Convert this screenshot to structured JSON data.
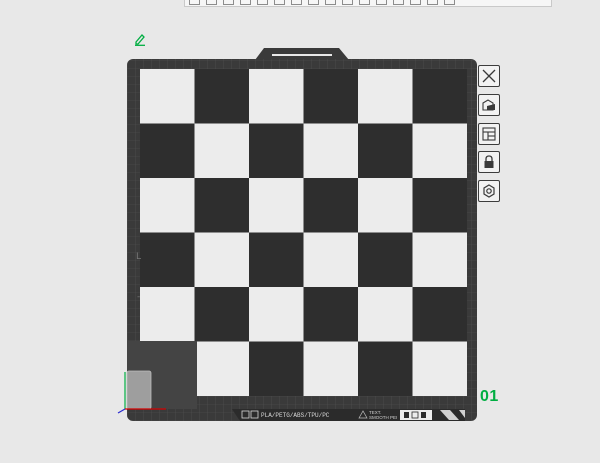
{
  "plate": {
    "number": "01",
    "filament_types": "PLA/PETG/ABS/TPU/PC",
    "surface_label_line1": "TEXT.",
    "surface_label_line2": "SMOOTH PEI",
    "board": {
      "rows": 6,
      "cols": 6,
      "dark": "#2e2e2e",
      "light": "#ececec"
    }
  },
  "toolbar": {
    "icons": [
      "add-object-icon",
      "add-plate-icon",
      "orient-icon",
      "arrange-icon",
      "split-icon",
      "move-icon",
      "rotate-icon",
      "scale-icon",
      "cut-icon",
      "measure-icon",
      "assembly-icon",
      "support-paint-icon",
      "seam-paint-icon",
      "color-paint-icon",
      "text-icon",
      "view-icon"
    ]
  },
  "side_buttons": [
    "close-plate-icon",
    "pick-plate-icon",
    "arrange-plate-icon",
    "lock-plate-icon",
    "plate-settings-icon"
  ],
  "colors": {
    "accent": "#00ae42",
    "plate_frame": "#3a3a3a",
    "grid_line": "#525252",
    "background": "#e8e8e8"
  }
}
